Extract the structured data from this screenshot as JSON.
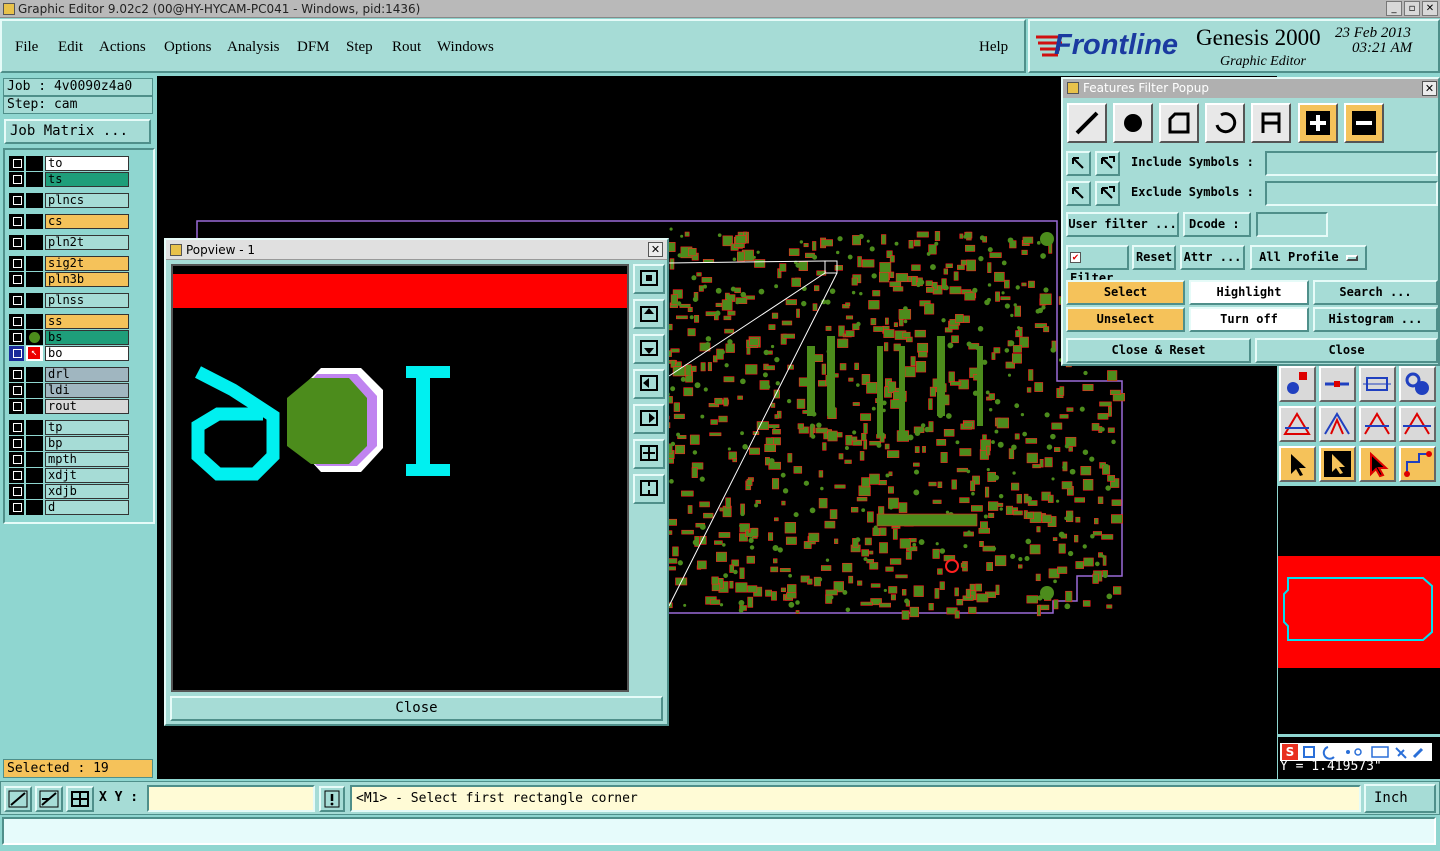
{
  "window": {
    "title": "Graphic Editor 9.02c2 (00@HY-HYCAM-PC041 - Windows, pid:1436)"
  },
  "menu": {
    "items": [
      "File",
      "Edit",
      "Actions",
      "Options",
      "Analysis",
      "DFM",
      "Step",
      "Rout",
      "Windows"
    ],
    "help": "Help"
  },
  "logo": {
    "brand": "Frontline",
    "product": "Genesis 2000",
    "subtitle": "Graphic Editor",
    "date": "23 Feb 2013",
    "time": "03:21 AM"
  },
  "job": {
    "job_line": "Job : 4v0090z4a0",
    "step_line": "Step: cam",
    "matrix_button": "Job Matrix ..."
  },
  "layers": [
    {
      "name": "to",
      "color": "#ffffff"
    },
    {
      "name": "ts",
      "color": "#1e9e7a"
    },
    {
      "name": "plncs",
      "color": "#a6dcd6"
    },
    {
      "name": "cs",
      "color": "#f5c25a"
    },
    {
      "name": "pln2t",
      "color": "#a6dcd6"
    },
    {
      "name": "sig2t",
      "color": "#f5c25a"
    },
    {
      "name": "pln3b",
      "color": "#f5c25a"
    },
    {
      "name": "plnss",
      "color": "#a6dcd6"
    },
    {
      "name": "ss",
      "color": "#f5c25a"
    },
    {
      "name": "bs",
      "color": "#1e9e7a"
    },
    {
      "name": "bo",
      "color": "#ffffff"
    },
    {
      "name": "drl",
      "color": "#a0b6c0"
    },
    {
      "name": "ldi",
      "color": "#a0b6c0"
    },
    {
      "name": "rout",
      "color": "#d8d8d8"
    },
    {
      "name": "tp",
      "color": "#a6dcd6"
    },
    {
      "name": "bp",
      "color": "#a6dcd6"
    },
    {
      "name": "mpth",
      "color": "#a6dcd6"
    },
    {
      "name": "xdjt",
      "color": "#a6dcd6"
    },
    {
      "name": "xdjb",
      "color": "#a6dcd6"
    },
    {
      "name": "d",
      "color": "#a6dcd6"
    }
  ],
  "selected_count": "Selected : 19",
  "popview": {
    "title": "Popview - 1",
    "close": "Close"
  },
  "filter_popup": {
    "title": "Features Filter Popup",
    "include_label": "Include Symbols :",
    "exclude_label": "Exclude Symbols :",
    "user_filter": "User filter ...",
    "dcode_label": "Dcode :",
    "filter_toggle": "Filter",
    "reset": "Reset",
    "attr": "Attr ...",
    "profile": "All Profile",
    "select": "Select",
    "highlight": "Highlight",
    "search": "Search ...",
    "unselect": "Unselect",
    "turn_off": "Turn off",
    "histogram": "Histogram ...",
    "close_reset": "Close & Reset",
    "close": "Close"
  },
  "coords": {
    "y_readout": "Y = 1.419573\""
  },
  "status": {
    "xy_label": "X Y :",
    "xy_value": "",
    "prompt": "<M1> - Select first rectangle corner",
    "units": "Inch"
  },
  "colors": {
    "panel": "#a6dcd6",
    "background": "#8fd6d0",
    "highlight": "#f5c25a",
    "copper": "#4c8c1c",
    "pad_red": "#ff0000"
  }
}
